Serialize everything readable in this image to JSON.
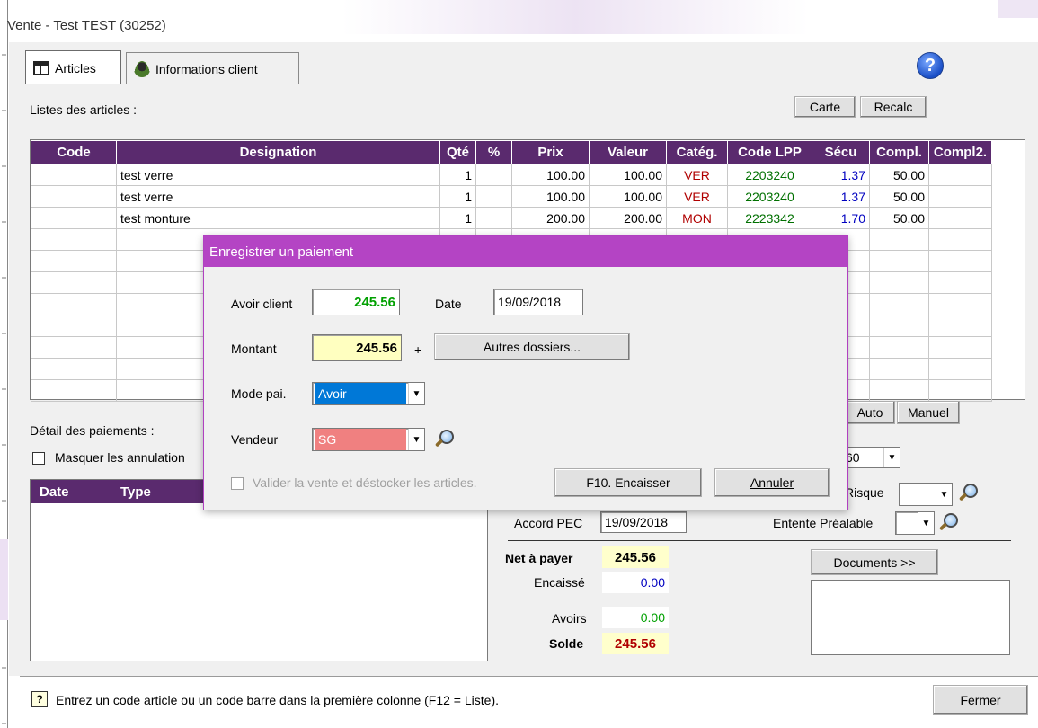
{
  "window": {
    "title": "Vente - Test TEST (30252)"
  },
  "tabs": [
    {
      "label": "Articles",
      "icon": "table-icon"
    },
    {
      "label": "Informations client",
      "icon": "client-icon"
    }
  ],
  "articles": {
    "section_label": "Listes des articles :",
    "buttons": {
      "carte": "Carte",
      "recalc": "Recalc"
    },
    "columns": [
      "Code",
      "Designation",
      "Qté",
      "%",
      "Prix",
      "Valeur",
      "Catég.",
      "Code LPP",
      "Sécu",
      "Compl.",
      "Compl2."
    ],
    "rows": [
      {
        "code": "",
        "designation": "test verre",
        "qte": "1",
        "pct": "",
        "prix": "100.00",
        "valeur": "100.00",
        "categ": "VER",
        "lpp": "2203240",
        "secu": "1.37",
        "compl": "50.00",
        "compl2": ""
      },
      {
        "code": "",
        "designation": "test verre",
        "qte": "1",
        "pct": "",
        "prix": "100.00",
        "valeur": "100.00",
        "categ": "VER",
        "lpp": "2203240",
        "secu": "1.37",
        "compl": "50.00",
        "compl2": ""
      },
      {
        "code": "",
        "designation": "test monture",
        "qte": "1",
        "pct": "",
        "prix": "200.00",
        "valeur": "200.00",
        "categ": "MON",
        "lpp": "2223342",
        "secu": "1.70",
        "compl": "50.00",
        "compl2": ""
      }
    ],
    "mode_buttons": {
      "auto": "Auto",
      "manuel": "Manuel"
    }
  },
  "payments": {
    "section_label": "Détail des paiements :",
    "mask_cancel_label": "Masquer les annulation",
    "columns": [
      "Date",
      "Type"
    ]
  },
  "right_panel": {
    "combo_value": "60",
    "risque_label": "Risque",
    "accord_label": "Accord PEC",
    "accord_value": "19/09/2018",
    "entente_label": "Entente Préalable",
    "documents_button": "Documents >>"
  },
  "totals": {
    "net_label": "Net à payer",
    "net_value": "245.56",
    "encaisse_label": "Encaissé",
    "encaisse_value": "0.00",
    "avoirs_label": "Avoirs",
    "avoirs_value": "0.00",
    "solde_label": "Solde",
    "solde_value": "245.56"
  },
  "status": {
    "hint": "Entrez un code article ou un code barre dans la première colonne (F12 = Liste).",
    "close_button": "Fermer"
  },
  "dialog": {
    "title": "Enregistrer un paiement",
    "avoir_label": "Avoir client",
    "avoir_value": "245.56",
    "date_label": "Date",
    "date_value": "19/09/2018",
    "montant_label": "Montant",
    "montant_value": "245.56",
    "plus": "+",
    "autres_button": "Autres dossiers...",
    "mode_label": "Mode pai.",
    "mode_value": "Avoir",
    "vendeur_label": "Vendeur",
    "vendeur_value": "SG",
    "valider_label": "Valider la vente et déstocker les articles.",
    "encaisser_button": "F10. Encaisser",
    "annuler_button": "Annuler"
  },
  "colors": {
    "header_purple": "#5a2a6e",
    "dialog_purple": "#b444c4",
    "green": "#00a000",
    "red": "#b00000",
    "blue": "#0000c0"
  }
}
